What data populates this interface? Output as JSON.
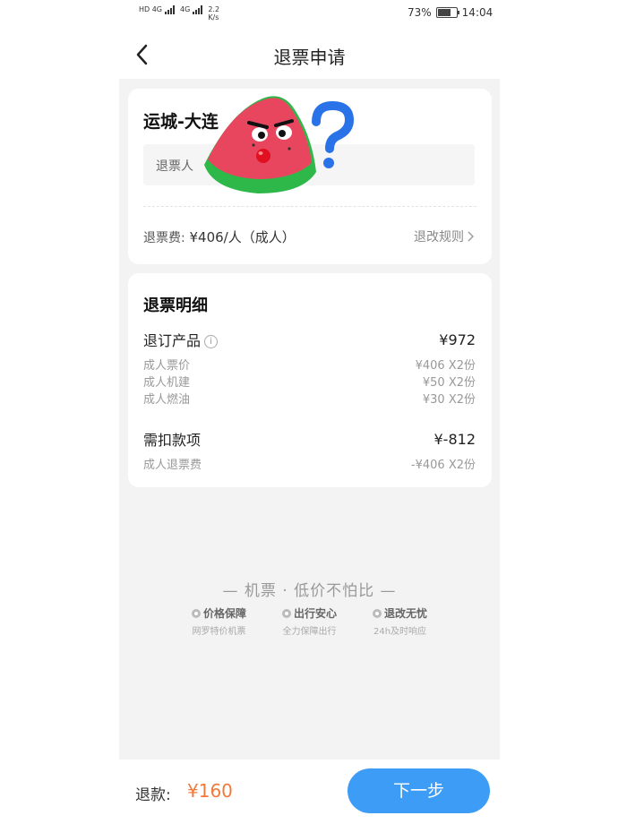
{
  "status_bar": {
    "left_net1": "HD 4G",
    "left_net2": "4G",
    "speed": "2.2",
    "speed_unit": "K/s",
    "battery_percent": "73%",
    "battery_level": 0.73,
    "time": "14:04"
  },
  "nav": {
    "title": "退票申请",
    "back_icon": "chevron-left-icon"
  },
  "ticket_card": {
    "route": "运城-大连",
    "passenger_label": "退票人",
    "fee_label": "退票费:",
    "fee_value": "¥406/人（成人）",
    "rules_link": "退改规则"
  },
  "detail_card": {
    "title": "退票明细",
    "refund_product_label": "退订产品",
    "refund_product_amount": "¥972",
    "items": [
      {
        "label": "成人票价",
        "value": "¥406  X2份"
      },
      {
        "label": "成人机建",
        "value": "¥50  X2份"
      },
      {
        "label": "成人燃油",
        "value": "¥30  X2份"
      }
    ],
    "deduction_label": "需扣款项",
    "deduction_amount": "¥-812",
    "deduction_items": [
      {
        "label": "成人退票费",
        "value": "-¥406  X2份"
      }
    ]
  },
  "promo": {
    "slogan": "— 机票 · 低价不怕比 —",
    "features": [
      {
        "title": "价格保障",
        "subtitle": "网罗特价机票"
      },
      {
        "title": "出行安心",
        "subtitle": "全力保障出行"
      },
      {
        "title": "退改无忧",
        "subtitle": "24h及时响应"
      }
    ]
  },
  "bottom": {
    "refund_label": "退款:",
    "refund_amount": "¥160",
    "next_button": "下一步"
  },
  "colors": {
    "accent_blue": "#3d9cf5",
    "refund_orange": "#f07a3a",
    "background_gray": "#f3f3f3"
  }
}
